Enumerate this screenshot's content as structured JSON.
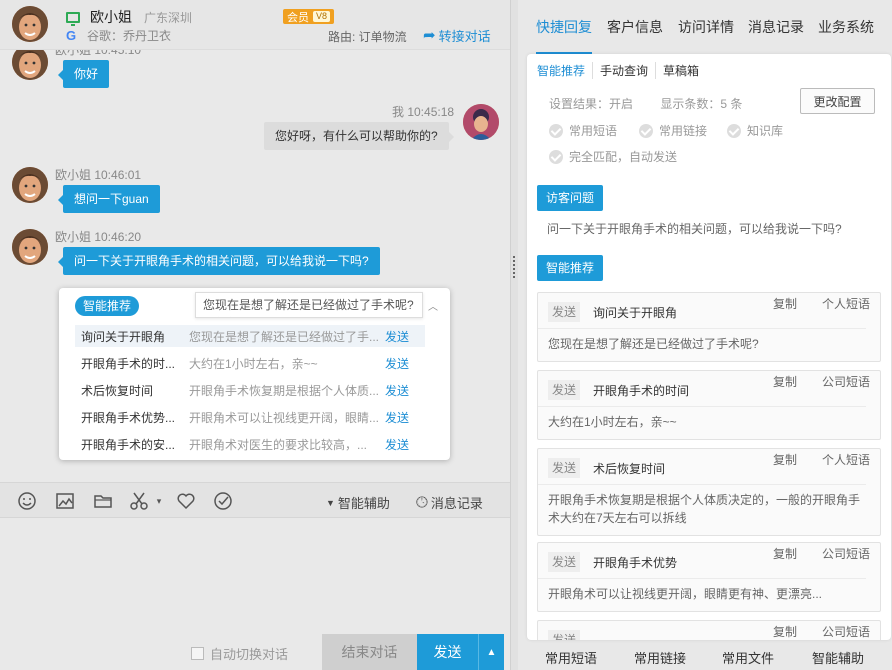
{
  "header": {
    "visitor_name": "欧小姐",
    "location": "广东深圳",
    "member_badge": "会员",
    "member_level": "V8",
    "source_label": "谷歌：乔丹卫衣",
    "route": "路由: 订单物流",
    "transfer_label": "转接对话"
  },
  "chat": {
    "truncated_meta": "欧小姐 10:45:10",
    "messages": [
      {
        "sender": "visitor",
        "text": "你好"
      },
      {
        "sender": "agent",
        "meta": "我 10:45:18",
        "text": "您好呀，有什么可以帮助你的?"
      },
      {
        "sender": "visitor",
        "meta": "欧小姐 10:46:01",
        "text": "想问一下guan"
      },
      {
        "sender": "visitor",
        "meta": "欧小姐 10:46:20",
        "text": "问一下关于开眼角手术的相关问题，可以给我说一下吗?"
      }
    ]
  },
  "suggest": {
    "tag": "智能推荐",
    "tooltip": "您现在是想了解还是已经做过了手术呢?",
    "send_label": "发送",
    "rows": [
      {
        "q": "询问关于开眼角",
        "a": "您现在是想了解还是已经做过了手..."
      },
      {
        "q": "开眼角手术的时...",
        "a": "大约在1小时左右，亲~~"
      },
      {
        "q": "术后恢复时间",
        "a": "开眼角手术恢复期是根据个人体质..."
      },
      {
        "q": "开眼角手术优势...",
        "a": "开眼角术可以让视线更开阔，眼睛..."
      },
      {
        "q": "开眼角手术的安...",
        "a": "开眼角术对医生的要求比较高，..."
      }
    ]
  },
  "toolbar": {
    "assist_label": "智能辅助",
    "history_label": "消息记录"
  },
  "bottom": {
    "auto_switch": "自动切换对话",
    "end": "结束对话",
    "send": "发送"
  },
  "right": {
    "tabs": [
      "快捷回复",
      "客户信息",
      "访问详情",
      "消息记录",
      "业务系统"
    ],
    "subtabs": [
      "智能推荐",
      "手动查询",
      "草稿箱"
    ],
    "config_result": "设置结果：开启",
    "config_count": "显示条数：5  条",
    "config_button": "更改配置",
    "checks": [
      "常用短语",
      "常用链接",
      "知识库",
      "完全匹配，自动发送"
    ],
    "visitor_q_tag": "访客问题",
    "visitor_q": "问一下关于开眼角手术的相关问题，可以给我说一下吗?",
    "recommend_tag": "智能推荐",
    "send_tag": "发送",
    "copy_label": "复制",
    "records": [
      {
        "q": "询问关于开眼角",
        "kind": "个人短语",
        "a": "您现在是想了解还是已经做过了手术呢?"
      },
      {
        "q": "开眼角手术的时间",
        "kind": "公司短语",
        "a": "大约在1小时左右，亲~~"
      },
      {
        "q": "术后恢复时间",
        "kind": "个人短语",
        "a": "开眼角手术恢复期是根据个人体质决定的，一般的开眼角手术大约在7天左右可以拆线"
      },
      {
        "q": "开眼角手术优势",
        "kind": "公司短语",
        "a": "开眼角术可以让视线更开阔，眼睛更有神、更漂亮..."
      },
      {
        "q": "",
        "kind": "公司短语",
        "a": ""
      }
    ],
    "bottom_tabs": [
      "常用短语",
      "常用链接",
      "常用文件",
      "智能辅助"
    ]
  },
  "colors": {
    "accent": "#1e9bd8",
    "link": "#1e8ed4",
    "badge": "#f0a020",
    "status_green": "#2eaa55"
  }
}
